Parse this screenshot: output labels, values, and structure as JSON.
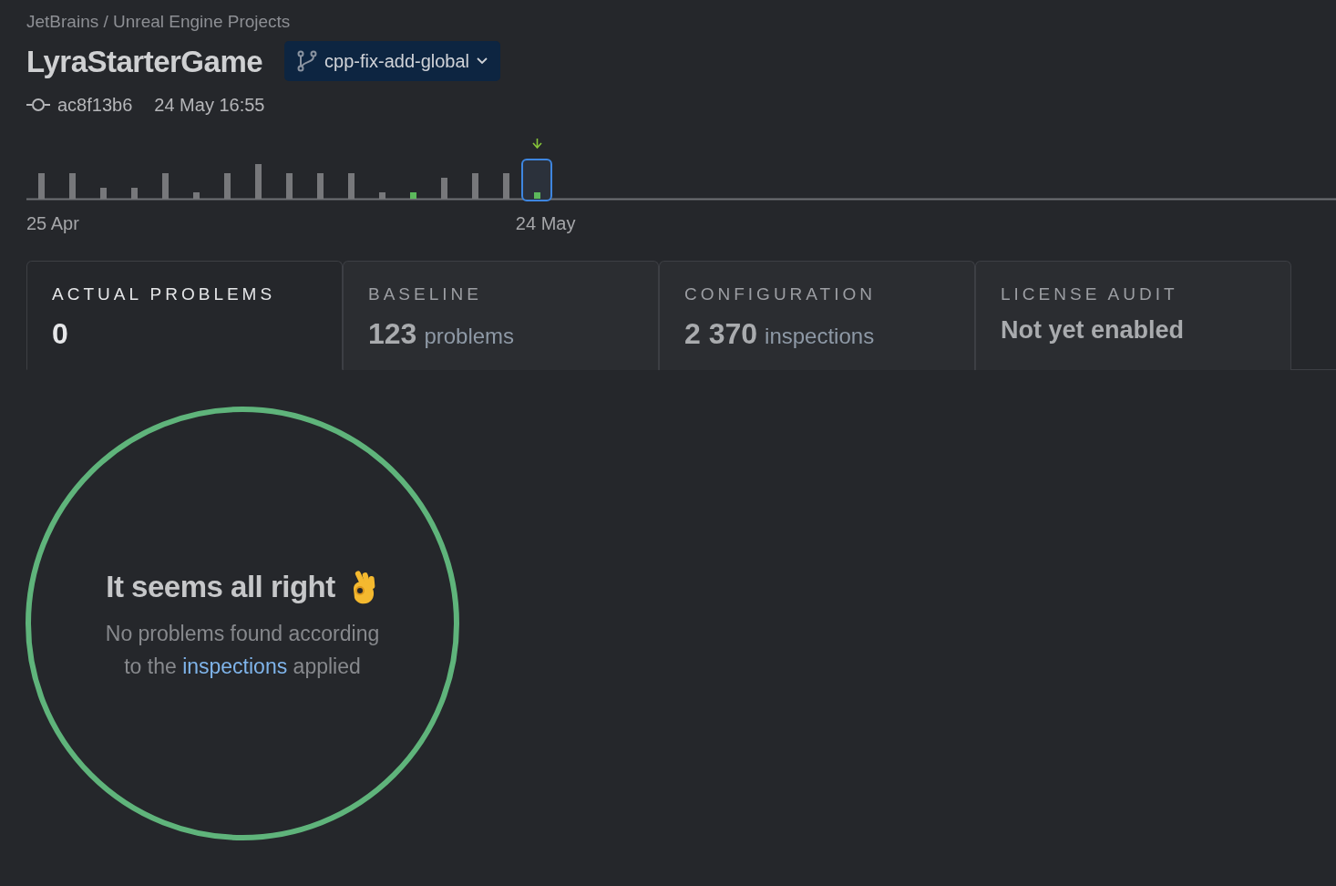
{
  "breadcrumb": "JetBrains / Unreal Engine Projects",
  "project": {
    "title": "LyraStarterGame",
    "branch": "cpp-fix-add-global"
  },
  "commit": {
    "hash": "ac8f13b6",
    "date": "24 May 16:55"
  },
  "timeline": {
    "start_label": "25 Apr",
    "end_label": "24 May",
    "builds": [
      {
        "passed": false,
        "selected": false
      },
      {
        "passed": false,
        "selected": false
      },
      {
        "passed": false,
        "selected": false
      },
      {
        "passed": false,
        "selected": false
      },
      {
        "passed": false,
        "selected": false
      },
      {
        "passed": false,
        "selected": false
      },
      {
        "passed": false,
        "selected": false
      },
      {
        "passed": false,
        "selected": false
      },
      {
        "passed": false,
        "selected": false
      },
      {
        "passed": false,
        "selected": false
      },
      {
        "passed": false,
        "selected": false
      },
      {
        "passed": false,
        "selected": false
      },
      {
        "passed": true,
        "selected": false
      },
      {
        "passed": false,
        "selected": false
      },
      {
        "passed": false,
        "selected": false
      },
      {
        "passed": false,
        "selected": false
      },
      {
        "passed": true,
        "selected": true
      }
    ]
  },
  "tabs": [
    {
      "label": "ACTUAL PROBLEMS",
      "value": "0",
      "selected": true
    },
    {
      "label": "BASELINE",
      "value": "123",
      "unit": "problems",
      "selected": false
    },
    {
      "label": "CONFIGURATION",
      "value": "2 370",
      "unit": "inspections",
      "selected": false
    },
    {
      "label": "LICENSE AUDIT",
      "value": "Not yet enabled",
      "selected": false
    }
  ],
  "result": {
    "title": "It seems all right",
    "line_1": "No problems found according",
    "line_2_before": "to the",
    "link": "inspections",
    "line_2_after": "applied"
  }
}
